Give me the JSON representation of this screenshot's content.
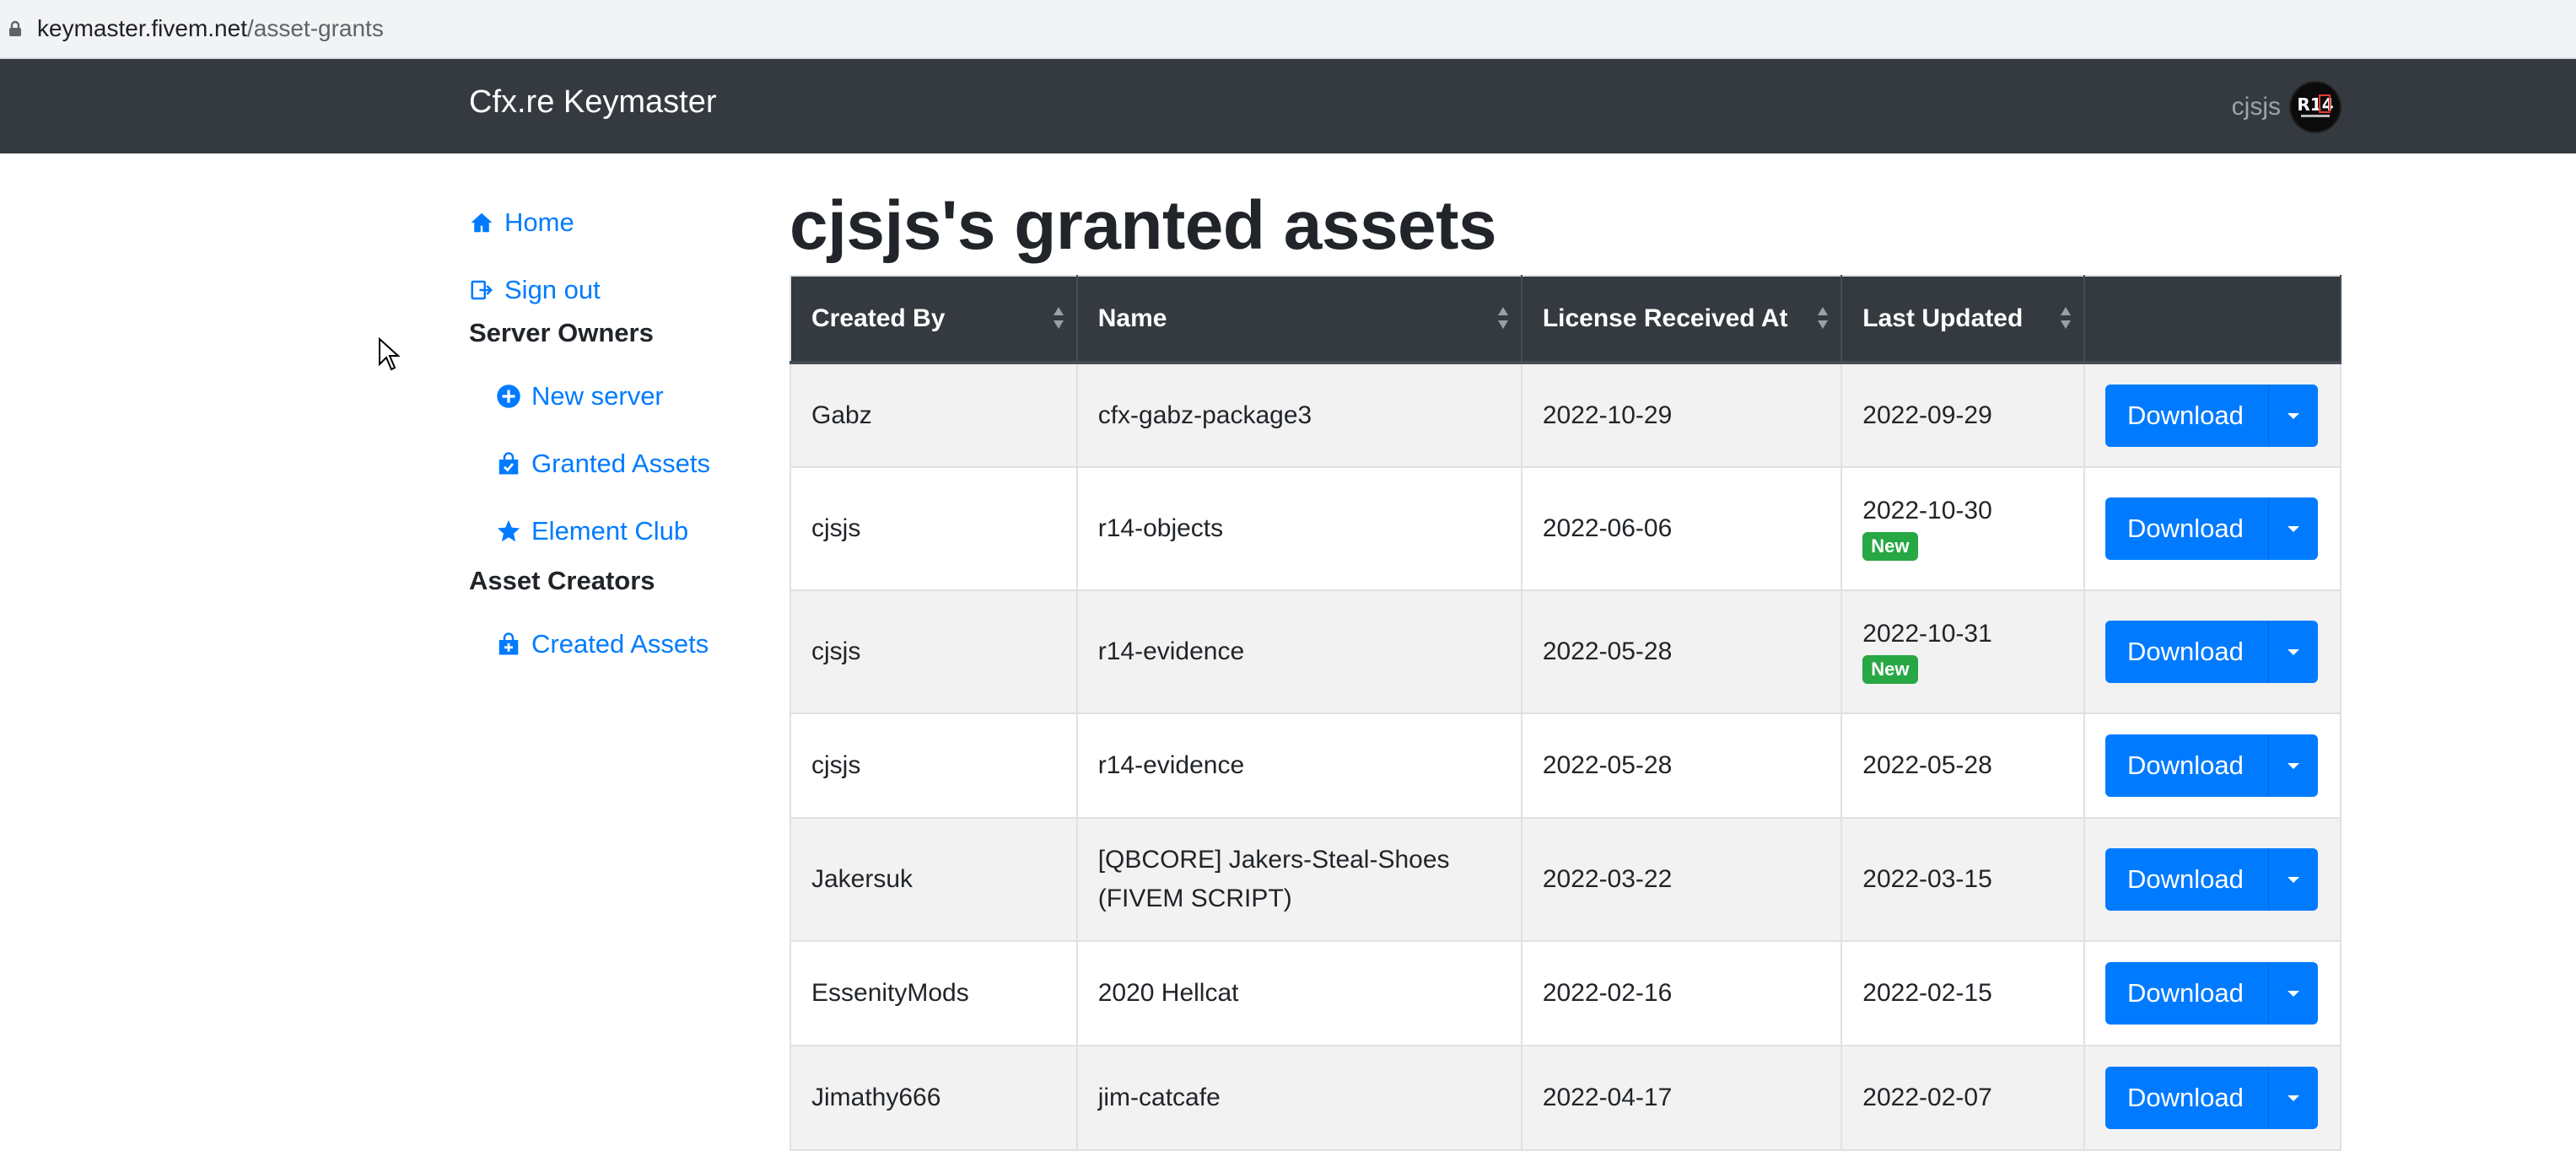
{
  "browser": {
    "url_host": "keymaster.fivem.net",
    "url_path": "/asset-grants"
  },
  "navbar": {
    "brand": "Cfx.re Keymaster",
    "username": "cjsjs",
    "avatar_text": "R14"
  },
  "sidebar": {
    "home": "Home",
    "sign_out": "Sign out",
    "server_owners_heading": "Server Owners",
    "new_server": "New server",
    "granted_assets": "Granted Assets",
    "element_club": "Element Club",
    "asset_creators_heading": "Asset Creators",
    "created_assets": "Created Assets"
  },
  "main": {
    "title": "cjsjs's granted assets",
    "columns": [
      "Created By",
      "Name",
      "License Received At",
      "Last Updated"
    ],
    "download_label": "Download",
    "new_badge": "New",
    "rows": [
      {
        "created_by": "Gabz",
        "name": "cfx-gabz-package3",
        "license_received": "2022-10-29",
        "last_updated": "2022-09-29",
        "is_new": false
      },
      {
        "created_by": "cjsjs",
        "name": "r14-objects",
        "license_received": "2022-06-06",
        "last_updated": "2022-10-30",
        "is_new": true
      },
      {
        "created_by": "cjsjs",
        "name": "r14-evidence",
        "license_received": "2022-05-28",
        "last_updated": "2022-10-31",
        "is_new": true
      },
      {
        "created_by": "cjsjs",
        "name": "r14-evidence",
        "license_received": "2022-05-28",
        "last_updated": "2022-05-28",
        "is_new": false
      },
      {
        "created_by": "Jakersuk",
        "name": "[QBCORE] Jakers-Steal-Shoes (FIVEM SCRIPT)",
        "license_received": "2022-03-22",
        "last_updated": "2022-03-15",
        "is_new": false
      },
      {
        "created_by": "EssenityMods",
        "name": "2020 Hellcat",
        "license_received": "2022-02-16",
        "last_updated": "2022-02-15",
        "is_new": false
      },
      {
        "created_by": "Jimathy666",
        "name": "jim-catcafe",
        "license_received": "2022-04-17",
        "last_updated": "2022-02-07",
        "is_new": false
      }
    ]
  },
  "colors": {
    "navbar": "#343a40",
    "link": "#007bff",
    "badge_new": "#28a745"
  }
}
